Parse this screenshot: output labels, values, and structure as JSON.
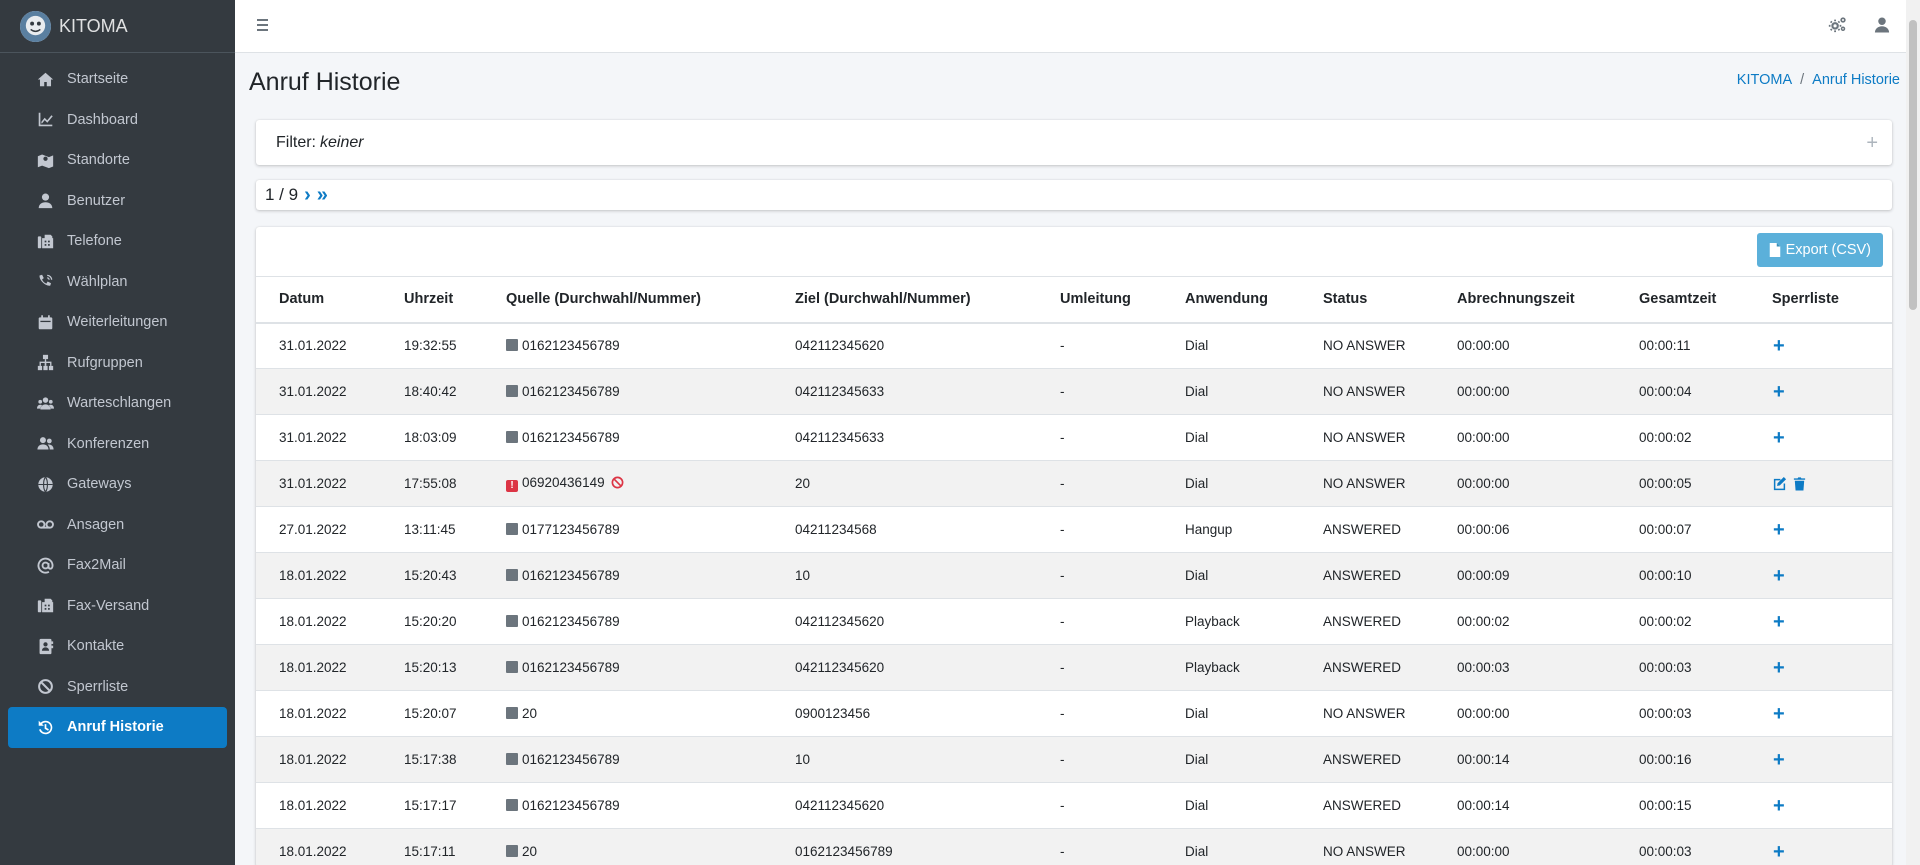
{
  "app": {
    "brand": "KITOMA"
  },
  "sidebar": {
    "items": [
      {
        "label": "Startseite",
        "icon": "home-icon"
      },
      {
        "label": "Dashboard",
        "icon": "chart-line-icon"
      },
      {
        "label": "Standorte",
        "icon": "map-icon"
      },
      {
        "label": "Benutzer",
        "icon": "user-icon"
      },
      {
        "label": "Telefone",
        "icon": "fax-icon"
      },
      {
        "label": "Wählplan",
        "icon": "phone-volume-icon"
      },
      {
        "label": "Weiterleitungen",
        "icon": "calendar-icon"
      },
      {
        "label": "Rufgruppen",
        "icon": "sitemap-icon"
      },
      {
        "label": "Warteschlangen",
        "icon": "users-icon"
      },
      {
        "label": "Konferenzen",
        "icon": "user-friends-icon"
      },
      {
        "label": "Gateways",
        "icon": "globe-icon"
      },
      {
        "label": "Ansagen",
        "icon": "voicemail-icon"
      },
      {
        "label": "Fax2Mail",
        "icon": "at-icon"
      },
      {
        "label": "Fax-Versand",
        "icon": "fax-icon"
      },
      {
        "label": "Kontakte",
        "icon": "address-book-icon"
      },
      {
        "label": "Sperrliste",
        "icon": "ban-icon"
      },
      {
        "label": "Anruf Historie",
        "icon": "history-icon",
        "active": true
      }
    ]
  },
  "header": {
    "title": "Anruf Historie",
    "breadcrumb": [
      "KITOMA",
      "Anruf Historie"
    ]
  },
  "filter": {
    "label": "Filter:",
    "value": "keiner",
    "toggle": "+"
  },
  "pager": {
    "text": "1 / 9",
    "next": "›",
    "last": "»"
  },
  "export_button": "Export (CSV)",
  "table": {
    "columns": [
      "Datum",
      "Uhrzeit",
      "Quelle (Durchwahl/Nummer)",
      "Ziel (Durchwahl/Nummer)",
      "Umleitung",
      "Anwendung",
      "Status",
      "Abrechnungszeit",
      "Gesamtzeit",
      "Sperrliste"
    ],
    "rows": [
      {
        "datum": "31.01.2022",
        "uhrzeit": "19:32:55",
        "quelle": "0162123456789",
        "ziel": "042112345620",
        "umleitung": "-",
        "anwendung": "Dial",
        "status": "NO ANSWER",
        "abrechnung": "00:00:00",
        "gesamt": "00:00:11",
        "blocked": false
      },
      {
        "datum": "31.01.2022",
        "uhrzeit": "18:40:42",
        "quelle": "0162123456789",
        "ziel": "042112345633",
        "umleitung": "-",
        "anwendung": "Dial",
        "status": "NO ANSWER",
        "abrechnung": "00:00:00",
        "gesamt": "00:00:04",
        "blocked": false
      },
      {
        "datum": "31.01.2022",
        "uhrzeit": "18:03:09",
        "quelle": "0162123456789",
        "ziel": "042112345633",
        "umleitung": "-",
        "anwendung": "Dial",
        "status": "NO ANSWER",
        "abrechnung": "00:00:00",
        "gesamt": "00:00:02",
        "blocked": false
      },
      {
        "datum": "31.01.2022",
        "uhrzeit": "17:55:08",
        "quelle": "06920436149",
        "ziel": "20",
        "umleitung": "-",
        "anwendung": "Dial",
        "status": "NO ANSWER",
        "abrechnung": "00:00:00",
        "gesamt": "00:00:05",
        "blocked": true
      },
      {
        "datum": "27.01.2022",
        "uhrzeit": "13:11:45",
        "quelle": "0177123456789",
        "ziel": "04211234568",
        "umleitung": "-",
        "anwendung": "Hangup",
        "status": "ANSWERED",
        "abrechnung": "00:00:06",
        "gesamt": "00:00:07",
        "blocked": false
      },
      {
        "datum": "18.01.2022",
        "uhrzeit": "15:20:43",
        "quelle": "0162123456789",
        "ziel": "10",
        "umleitung": "-",
        "anwendung": "Dial",
        "status": "ANSWERED",
        "abrechnung": "00:00:09",
        "gesamt": "00:00:10",
        "blocked": false
      },
      {
        "datum": "18.01.2022",
        "uhrzeit": "15:20:20",
        "quelle": "0162123456789",
        "ziel": "042112345620",
        "umleitung": "-",
        "anwendung": "Playback",
        "status": "ANSWERED",
        "abrechnung": "00:00:02",
        "gesamt": "00:00:02",
        "blocked": false
      },
      {
        "datum": "18.01.2022",
        "uhrzeit": "15:20:13",
        "quelle": "0162123456789",
        "ziel": "042112345620",
        "umleitung": "-",
        "anwendung": "Playback",
        "status": "ANSWERED",
        "abrechnung": "00:00:03",
        "gesamt": "00:00:03",
        "blocked": false
      },
      {
        "datum": "18.01.2022",
        "uhrzeit": "15:20:07",
        "quelle": "20",
        "ziel": "0900123456",
        "umleitung": "-",
        "anwendung": "Dial",
        "status": "NO ANSWER",
        "abrechnung": "00:00:00",
        "gesamt": "00:00:03",
        "blocked": false
      },
      {
        "datum": "18.01.2022",
        "uhrzeit": "15:17:38",
        "quelle": "0162123456789",
        "ziel": "10",
        "umleitung": "-",
        "anwendung": "Dial",
        "status": "ANSWERED",
        "abrechnung": "00:00:14",
        "gesamt": "00:00:16",
        "blocked": false
      },
      {
        "datum": "18.01.2022",
        "uhrzeit": "15:17:17",
        "quelle": "0162123456789",
        "ziel": "042112345620",
        "umleitung": "-",
        "anwendung": "Dial",
        "status": "ANSWERED",
        "abrechnung": "00:00:14",
        "gesamt": "00:00:15",
        "blocked": false
      },
      {
        "datum": "18.01.2022",
        "uhrzeit": "15:17:11",
        "quelle": "20",
        "ziel": "0162123456789",
        "umleitung": "-",
        "anwendung": "Dial",
        "status": "NO ANSWER",
        "abrechnung": "00:00:00",
        "gesamt": "00:00:03",
        "blocked": false
      }
    ]
  }
}
